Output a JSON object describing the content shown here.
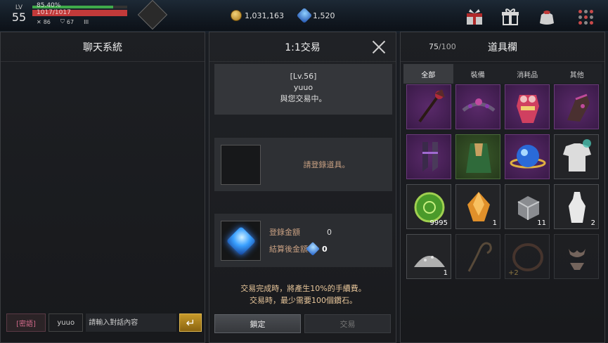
{
  "hud": {
    "level_label": "LV",
    "level": "55",
    "exp_percent_text": "85.40%",
    "exp_fraction": 0.854,
    "hp_text": "1017/1017",
    "hp_fraction": 1.0,
    "stats": [
      {
        "icon": "swords-icon",
        "value": "86"
      },
      {
        "icon": "shield-icon",
        "value": "67"
      },
      {
        "icon": "rank-icon",
        "value": "III"
      }
    ],
    "gold": "1,031,163",
    "diamonds": "1,520",
    "buttons": [
      "gift-box-icon",
      "present-icon",
      "pouch-icon",
      "menu-grid-icon"
    ]
  },
  "chat": {
    "title": "聊天系統",
    "whisper_label": "[密語]",
    "target_name": "yuuo",
    "input_placeholder": "請輸入對話內容",
    "send_icon": "enter-icon"
  },
  "trade": {
    "title": "1:1交易",
    "partner_level": "[Lv.56]",
    "partner_name": "yuuo",
    "partner_status": "與您交易中。",
    "register_item_text": "請登錄道具。",
    "registered_amount_label": "登錄金額",
    "registered_amount_value": "0",
    "after_settlement_label": "結算後金額",
    "after_settlement_value": "0",
    "fee_note_line1": "交易完成時，將產生10%的手續費。",
    "fee_note_line2": "交易時，最少需要100個鑽石。",
    "lock_button": "鎖定",
    "trade_button": "交易"
  },
  "inventory": {
    "count_current": "75",
    "count_max": "100",
    "title": "道具欄",
    "tabs": [
      "全部",
      "裝備",
      "消耗品",
      "其他"
    ],
    "active_tab": 0,
    "items": [
      {
        "name": "staff-item",
        "rarity": "purple",
        "qty": ""
      },
      {
        "name": "tiara-item",
        "rarity": "purple",
        "qty": ""
      },
      {
        "name": "dress-armor-item",
        "rarity": "purple",
        "qty": ""
      },
      {
        "name": "gauntlet-item",
        "rarity": "purple",
        "qty": ""
      },
      {
        "name": "boots-item",
        "rarity": "purple",
        "qty": ""
      },
      {
        "name": "cloak-item",
        "rarity": "green",
        "qty": ""
      },
      {
        "name": "orb-ring-item",
        "rarity": "purple",
        "qty": ""
      },
      {
        "name": "shirt-item",
        "rarity": "dark",
        "qty": ""
      },
      {
        "name": "green-coin-item",
        "rarity": "dark",
        "qty": "9995"
      },
      {
        "name": "amber-stone-item",
        "rarity": "dark",
        "qty": "1"
      },
      {
        "name": "ore-cube-item",
        "rarity": "dark",
        "qty": "11"
      },
      {
        "name": "milk-bottle-item",
        "rarity": "dark",
        "qty": "2"
      },
      {
        "name": "powder-pile-item",
        "rarity": "dark",
        "qty": "1"
      },
      {
        "name": "whip-item",
        "rarity": "faded",
        "qty": ""
      },
      {
        "name": "circlet-item",
        "rarity": "faded",
        "qty": "",
        "enh": "+2"
      },
      {
        "name": "bikini-item",
        "rarity": "faded",
        "qty": ""
      }
    ]
  },
  "colors": {
    "exp_bar": "#3faa4a",
    "hp_bar": "#c23a3a",
    "accent_gold": "#c79a2a",
    "note_text": "#e8c69a"
  }
}
